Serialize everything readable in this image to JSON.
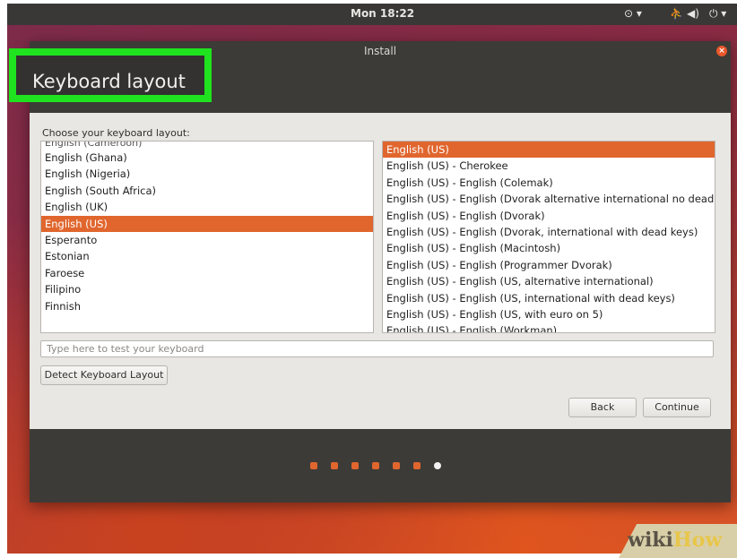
{
  "topbar": {
    "clock": "Mon 18:22",
    "tray": {
      "network_icon": "network-icon",
      "accessibility_icon": "accessibility-icon",
      "volume_icon": "volume-icon",
      "power_icon": "power-icon"
    }
  },
  "window": {
    "title": "Install",
    "page_title": "Keyboard layout",
    "prompt": "Choose your keyboard layout:",
    "left_list": {
      "partial_top": "English (Cameroon)",
      "items": [
        "English (Cameroon)",
        "English (Ghana)",
        "English (Nigeria)",
        "English (South Africa)",
        "English (UK)",
        "English (US)",
        "Esperanto",
        "Estonian",
        "Faroese",
        "Filipino",
        "Finnish"
      ],
      "selected": "English (US)"
    },
    "right_list": {
      "items": [
        "English (US)",
        "English (US) - Cherokee",
        "English (US) - English (Colemak)",
        "English (US) - English (Dvorak alternative international no dead keys)",
        "English (US) - English (Dvorak)",
        "English (US) - English (Dvorak, international with dead keys)",
        "English (US) - English (Macintosh)",
        "English (US) - English (Programmer Dvorak)",
        "English (US) - English (US, alternative international)",
        "English (US) - English (US, international with dead keys)",
        "English (US) - English (US, with euro on 5)",
        "English (US) - English (Workman)"
      ],
      "selected": "English (US)"
    },
    "test_input_placeholder": "Type here to test your keyboard",
    "detect_button": "Detect Keyboard Layout",
    "back_button": "Back",
    "continue_button": "Continue"
  },
  "progress": {
    "total_steps": 7,
    "current_step": 7
  },
  "watermark": {
    "wiki": "wiki",
    "how": "How"
  },
  "colors": {
    "accent": "#e0662e",
    "highlight": "#1fe31f",
    "dark": "#3c3b37"
  }
}
